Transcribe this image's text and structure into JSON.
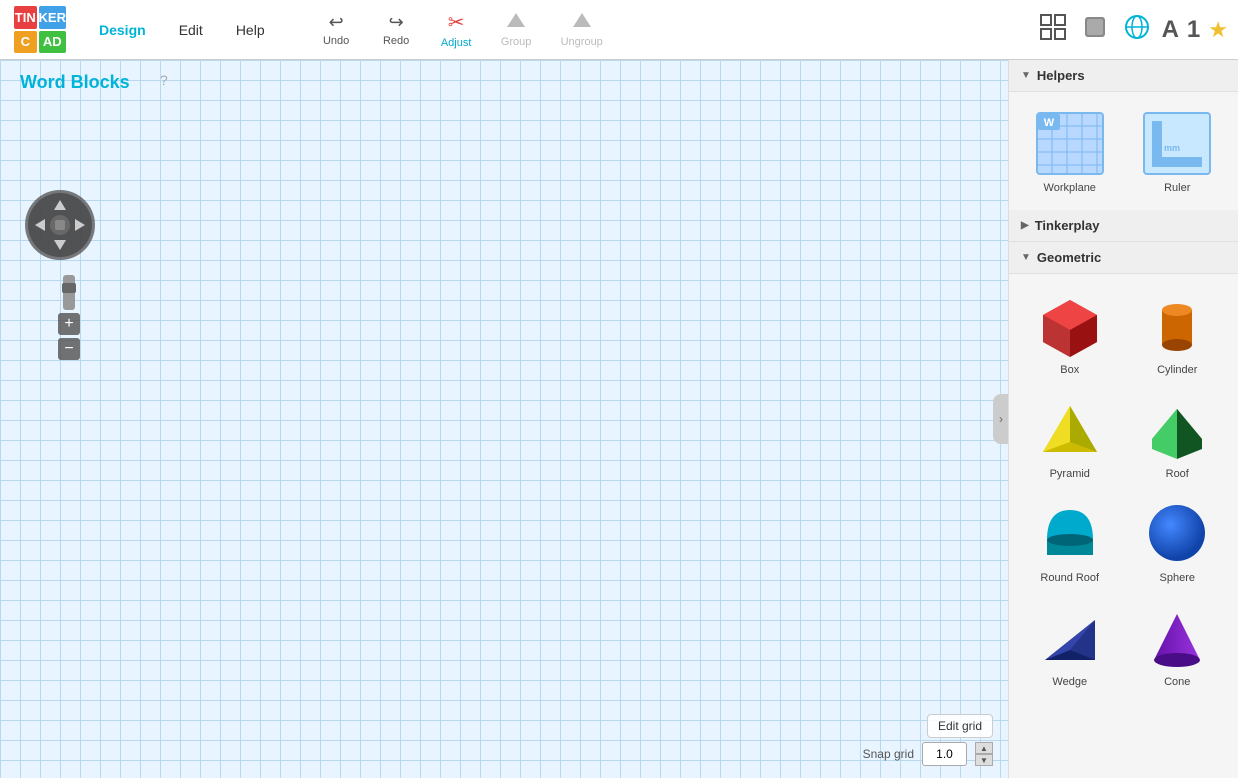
{
  "app": {
    "title": "Word Blocks",
    "logo": {
      "cells": [
        "TIN",
        "KER",
        "C",
        "AD"
      ]
    }
  },
  "nav": {
    "items": [
      {
        "id": "design",
        "label": "Design",
        "active": true
      },
      {
        "id": "edit",
        "label": "Edit",
        "active": false
      },
      {
        "id": "help",
        "label": "Help",
        "active": false
      }
    ]
  },
  "toolbar": {
    "undo": {
      "label": "Undo",
      "icon": "↩",
      "enabled": true
    },
    "redo": {
      "label": "Redo",
      "icon": "↪",
      "enabled": true
    },
    "adjust": {
      "label": "Adjust",
      "icon": "✂",
      "enabled": true,
      "active": true
    },
    "group": {
      "label": "Group",
      "icon": "▲",
      "enabled": false
    },
    "ungroup": {
      "label": "Ungroup",
      "icon": "▲",
      "enabled": false
    }
  },
  "right_tools": {
    "grid_icon": "⊞",
    "cube_icon": "◼",
    "globe_icon": "◉",
    "text_a": "A",
    "number_1": "1",
    "star": "★"
  },
  "canvas": {
    "title": "Word Blocks",
    "help_hint": "?",
    "edit_grid_label": "Edit grid",
    "snap_grid_label": "Snap grid",
    "snap_value": "1.0"
  },
  "right_panel": {
    "sections": [
      {
        "id": "helpers",
        "label": "Helpers",
        "expanded": true,
        "items": [
          {
            "id": "workplane",
            "label": "Workplane"
          },
          {
            "id": "ruler",
            "label": "Ruler"
          }
        ]
      },
      {
        "id": "tinkerplay",
        "label": "Tinkerplay",
        "expanded": false,
        "items": []
      },
      {
        "id": "geometric",
        "label": "Geometric",
        "expanded": true,
        "items": [
          {
            "id": "box",
            "label": "Box",
            "color": "#cc2222"
          },
          {
            "id": "cylinder",
            "label": "Cylinder",
            "color": "#cc6600"
          },
          {
            "id": "pyramid",
            "label": "Pyramid",
            "color": "#ddcc00"
          },
          {
            "id": "roof",
            "label": "Roof",
            "color": "#22aa44"
          },
          {
            "id": "round-roof",
            "label": "Round Roof",
            "color": "#00aacc"
          },
          {
            "id": "sphere",
            "label": "Sphere",
            "color": "#1166cc"
          },
          {
            "id": "wedge",
            "label": "Wedge",
            "color": "#223388"
          },
          {
            "id": "cone",
            "label": "Cone",
            "color": "#8822cc"
          }
        ]
      }
    ]
  }
}
